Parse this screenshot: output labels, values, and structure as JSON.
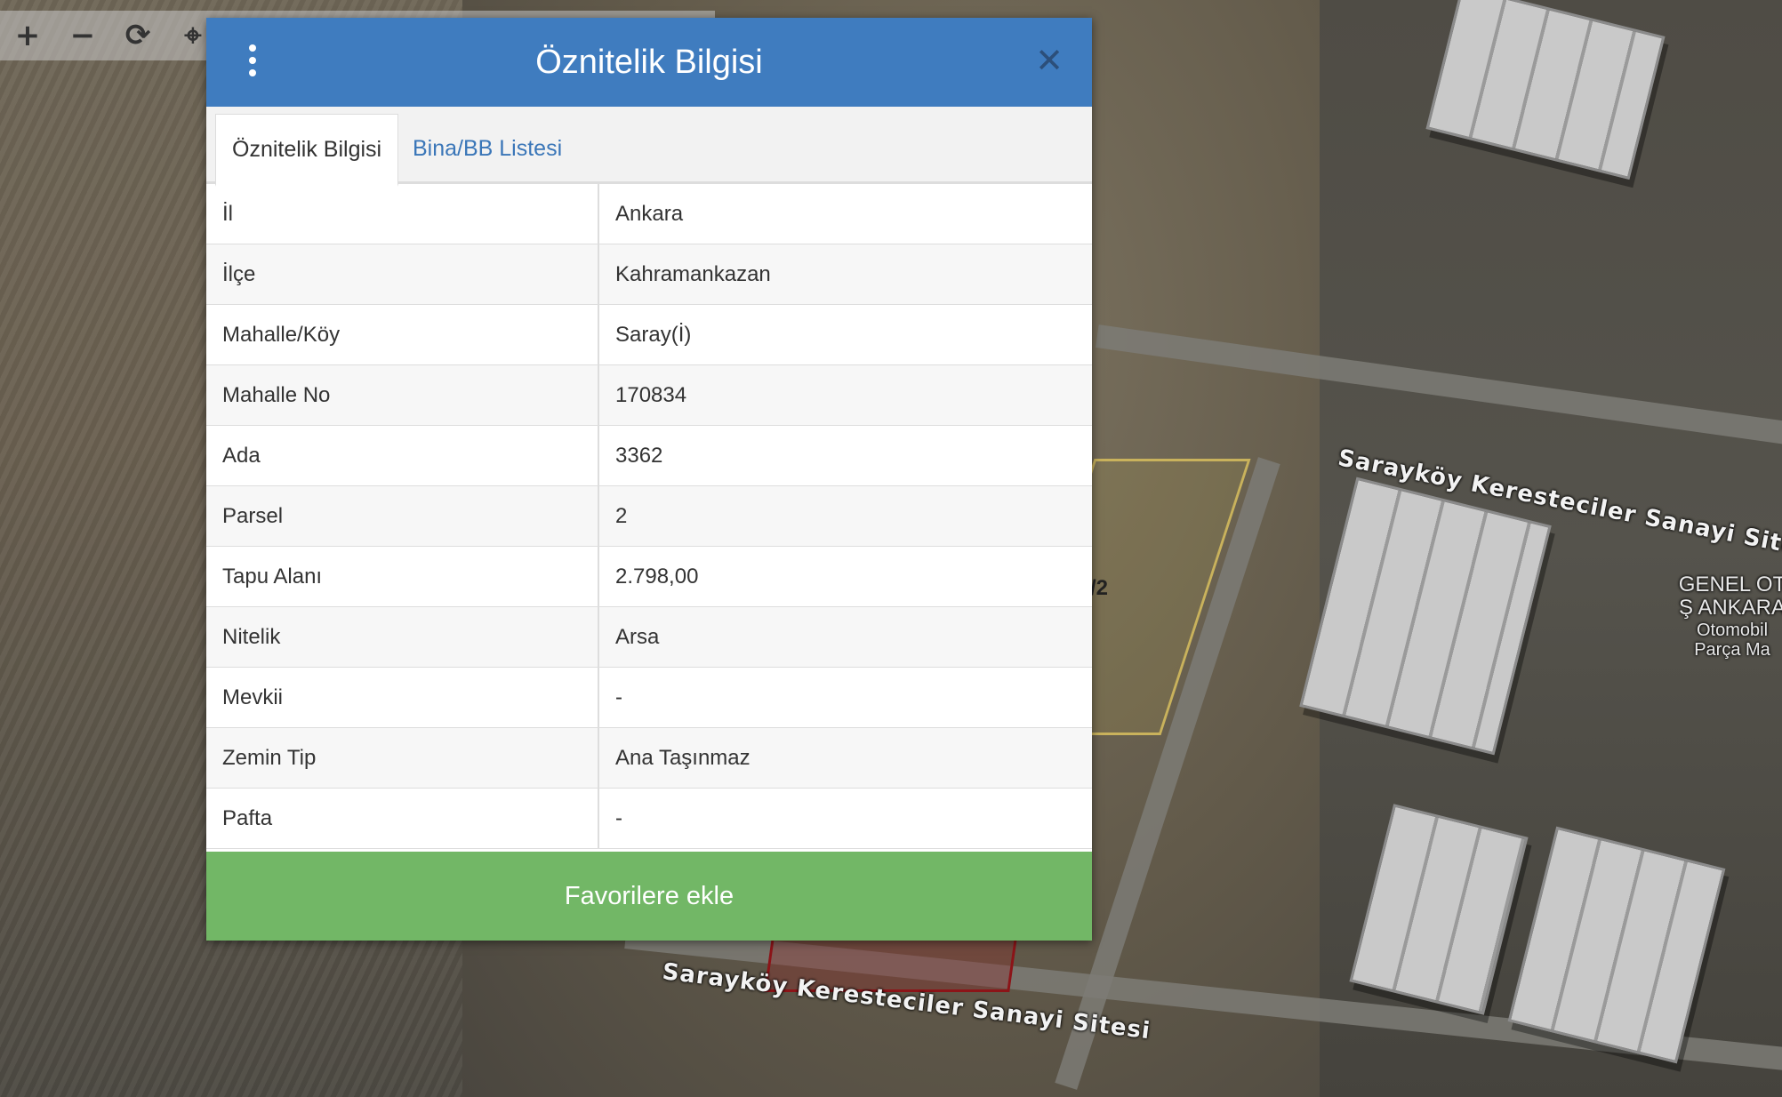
{
  "toolbar": {
    "zoom_in": "+",
    "zoom_out": "−",
    "refresh": "⟳",
    "locate": "⌖"
  },
  "map": {
    "road_label_1": "Sarayköy Keresteciler Sanayi Sitesi",
    "road_label_2": "Sarayköy Keresteciler Sanayi Sitesi",
    "place_line_1": "GENEL OT",
    "place_line_2": "Ş ANKARA",
    "place_line_3": "Otomobil",
    "place_line_4": "Parça Ma",
    "parcel_number": "/2"
  },
  "modal": {
    "title": "Öznitelik Bilgisi",
    "close": "✕",
    "tabs": [
      {
        "label": "Öznitelik Bilgisi"
      },
      {
        "label": "Bina/BB Listesi"
      }
    ],
    "rows": [
      {
        "key": "İl",
        "value": "Ankara"
      },
      {
        "key": "İlçe",
        "value": "Kahramankazan"
      },
      {
        "key": "Mahalle/Köy",
        "value": "Saray(İ)"
      },
      {
        "key": "Mahalle No",
        "value": "170834"
      },
      {
        "key": "Ada",
        "value": "3362"
      },
      {
        "key": "Parsel",
        "value": "2"
      },
      {
        "key": "Tapu Alanı",
        "value": "2.798,00"
      },
      {
        "key": "Nitelik",
        "value": "Arsa"
      },
      {
        "key": "Mevkii",
        "value": "-"
      },
      {
        "key": "Zemin Tip",
        "value": "Ana Taşınmaz"
      },
      {
        "key": "Pafta",
        "value": "-"
      }
    ],
    "favorite_button": "Favorilere ekle"
  },
  "colors": {
    "header": "#3f7cbf",
    "favorite": "#72b766",
    "tab_link": "#3a76b8"
  }
}
